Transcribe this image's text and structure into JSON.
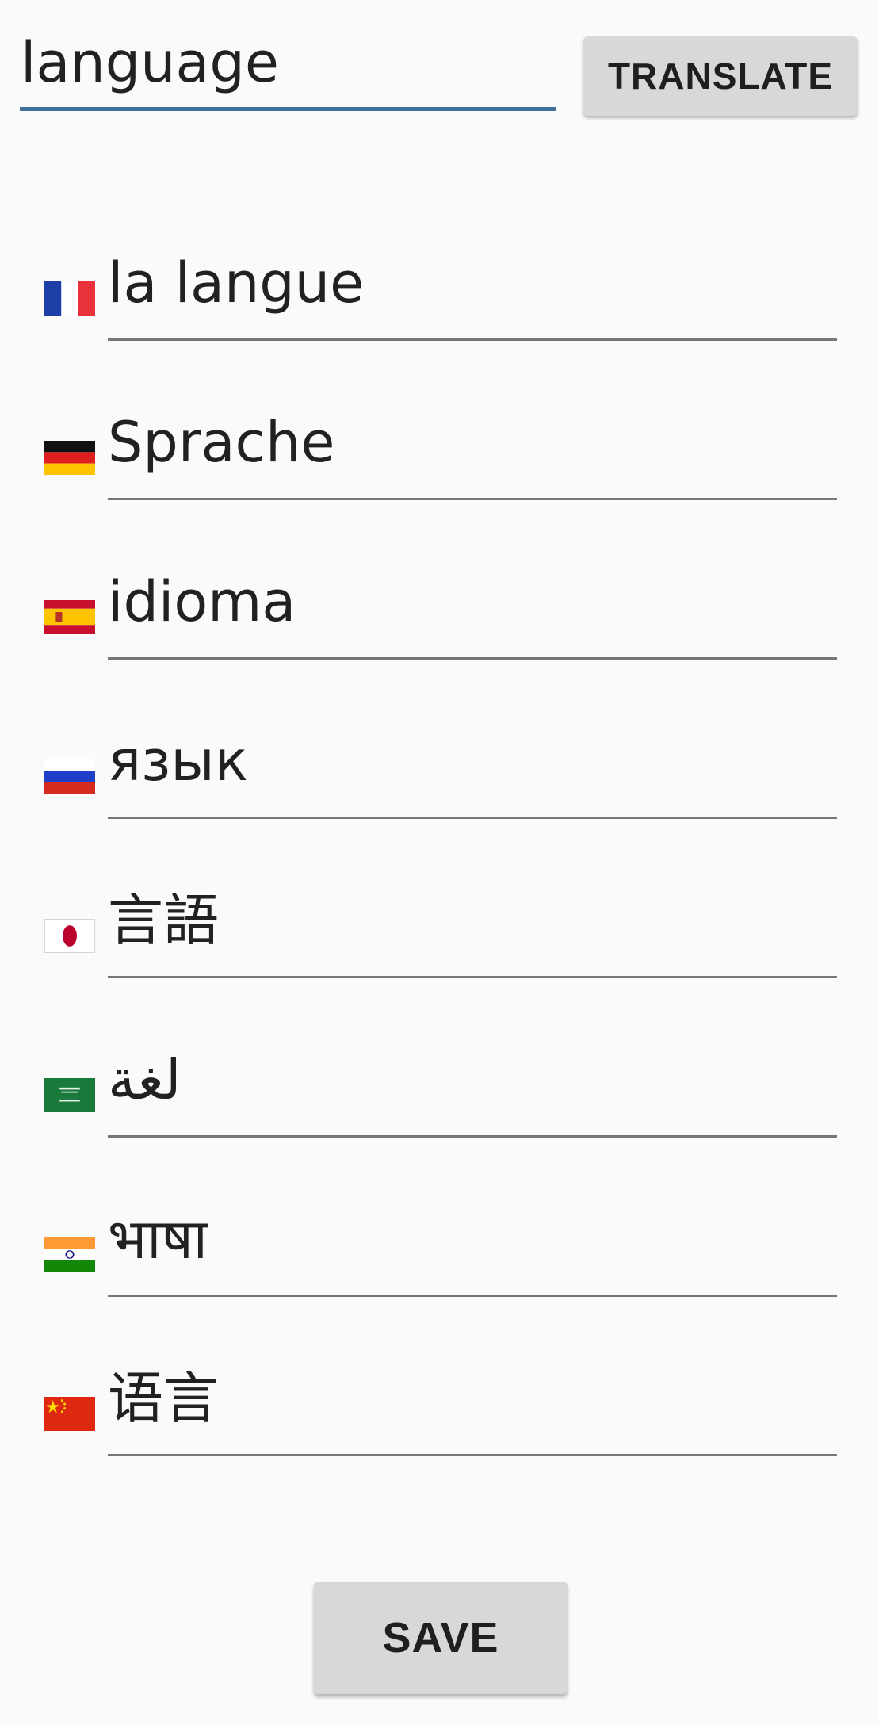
{
  "source": {
    "value": "language"
  },
  "toolbar": {
    "translate_label": "TRANSLATE"
  },
  "translations": [
    {
      "lang": "French",
      "flag_icon": "flag-france-icon",
      "text": "la langue"
    },
    {
      "lang": "German",
      "flag_icon": "flag-germany-icon",
      "text": "Sprache"
    },
    {
      "lang": "Spanish",
      "flag_icon": "flag-spain-icon",
      "text": "idioma"
    },
    {
      "lang": "Russian",
      "flag_icon": "flag-russia-icon",
      "text": "язык"
    },
    {
      "lang": "Japanese",
      "flag_icon": "flag-japan-icon",
      "text": "言語"
    },
    {
      "lang": "Arabic",
      "flag_icon": "flag-saudi-arabia-icon",
      "text": "لغة"
    },
    {
      "lang": "Hindi",
      "flag_icon": "flag-india-icon",
      "text": "भाषा"
    },
    {
      "lang": "Chinese",
      "flag_icon": "flag-china-icon",
      "text": "语言"
    }
  ],
  "footer": {
    "save_label": "SAVE"
  },
  "colors": {
    "background": "#fafafa",
    "input_underline_active": "#3f6e99",
    "field_underline": "#777777",
    "button_bg": "#d8d8d8",
    "text": "#212121"
  }
}
